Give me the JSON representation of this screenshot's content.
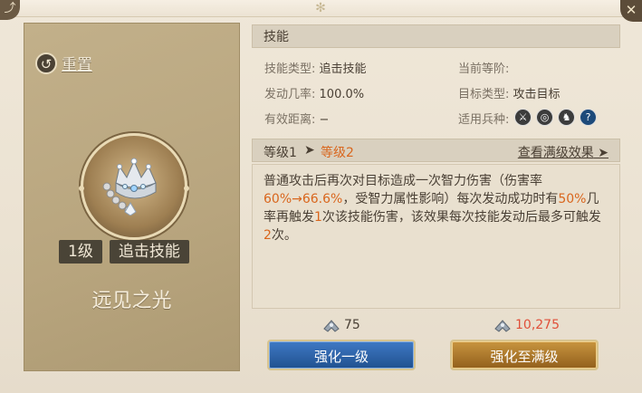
{
  "window": {
    "corner_icon": "back-icon",
    "close_icon": "close-icon"
  },
  "card": {
    "reset_label": "重置",
    "level_tag": "1级",
    "type_tag": "追击技能",
    "skill_name": "远见之光"
  },
  "skill": {
    "section_title": "技能",
    "fields": {
      "type_label": "技能类型:",
      "type_value": "追击技能",
      "current_level_label": "当前等阶:",
      "current_level_value": "",
      "trigger_label": "发动几率:",
      "trigger_value": "100.0%",
      "target_label": "目标类型:",
      "target_value": "攻击目标",
      "range_label": "有效距离:",
      "range_value": "−",
      "units_label": "适用兵种:"
    },
    "unit_icons": [
      "sword-icon",
      "target-icon",
      "horse-icon",
      "question-icon"
    ]
  },
  "levels": {
    "from": "等级1",
    "arrow": "➤",
    "to": "等级2",
    "view_max": "查看满级效果"
  },
  "description": {
    "p1": "普通攻击后再次对目标造成一次智力伤害（伤害率",
    "dmg_from": "60%",
    "dmg_arrow_to": "→66.6%",
    "p2": "，受智力属性影响）每次发动成功时有",
    "chance": "50%",
    "p3": "几率再触发",
    "times1": "1",
    "p4": "次该技能伤害，该效果每次技能发动后最多可触发",
    "times2": "2",
    "p5": "次。"
  },
  "upgrade": {
    "cost_one": "75",
    "cost_max": "10,275",
    "btn_one": "强化一级",
    "btn_max": "强化至满级"
  },
  "colors": {
    "highlight": "#d9661d",
    "cost_max_color": "#e0503a",
    "blue_button": "#2c64ab",
    "gold_button": "#b07a2d"
  }
}
